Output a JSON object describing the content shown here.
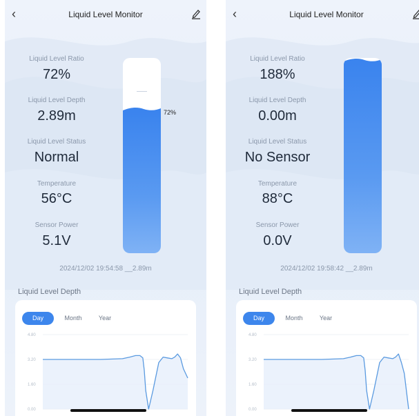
{
  "screens": [
    {
      "header": {
        "title": "Liquid Level Monitor"
      },
      "stats": [
        {
          "label": "Liquid Level Ratio",
          "value": "72%"
        },
        {
          "label": "Liquid Level Depth",
          "value": "2.89m"
        },
        {
          "label": "Liquid Level Status",
          "value": "Normal"
        },
        {
          "label": "Temperature",
          "value": "56°C"
        },
        {
          "label": "Sensor Power",
          "value": "5.1V"
        }
      ],
      "tank": {
        "fill_fraction": 0.72,
        "percent_label": "72%"
      },
      "timestamp": "2024/12/02 19:54:58 __2.89m",
      "chart_section": {
        "title": "Liquid Level Depth",
        "tabs": [
          "Day",
          "Month",
          "Year"
        ],
        "active_tab": "Day"
      },
      "chart_data": {
        "type": "area",
        "title": "Liquid Level Depth",
        "y_ticks": [
          "4.80",
          "3.20",
          "1.60",
          "0.00"
        ],
        "ylim": [
          0,
          4.8
        ],
        "x": [
          0,
          0.4,
          0.55,
          0.6,
          0.64,
          0.67,
          0.69,
          0.7,
          0.71,
          0.73,
          0.76,
          0.8,
          0.83,
          0.86,
          0.89,
          0.91,
          0.93,
          0.95,
          0.97,
          1.0
        ],
        "y": [
          3.2,
          3.2,
          3.25,
          3.35,
          3.45,
          3.45,
          3.3,
          2.5,
          1.2,
          0.0,
          1.2,
          3.0,
          3.35,
          3.3,
          3.25,
          3.35,
          3.55,
          3.3,
          2.6,
          2.0
        ]
      }
    },
    {
      "header": {
        "title": "Liquid Level Monitor"
      },
      "stats": [
        {
          "label": "Liquid Level Ratio",
          "value": "188%"
        },
        {
          "label": "Liquid Level Depth",
          "value": "0.00m"
        },
        {
          "label": "Liquid Level Status",
          "value": "No Sensor"
        },
        {
          "label": "Temperature",
          "value": "88°C"
        },
        {
          "label": "Sensor Power",
          "value": "0.0V"
        }
      ],
      "tank": {
        "fill_fraction": 1.0,
        "percent_label": ""
      },
      "timestamp": "2024/12/02 19:58:42 __2.89m",
      "chart_section": {
        "title": "Liquid Level Depth",
        "tabs": [
          "Day",
          "Month",
          "Year"
        ],
        "active_tab": "Day"
      },
      "chart_data": {
        "type": "area",
        "title": "Liquid Level Depth",
        "y_ticks": [
          "4.80",
          "3.20",
          "1.60",
          "0.00"
        ],
        "ylim": [
          0,
          4.8
        ],
        "x": [
          0,
          0.4,
          0.55,
          0.6,
          0.64,
          0.67,
          0.69,
          0.7,
          0.71,
          0.73,
          0.76,
          0.8,
          0.83,
          0.86,
          0.89,
          0.91,
          0.93,
          0.95,
          0.97,
          1.0
        ],
        "y": [
          3.2,
          3.2,
          3.25,
          3.35,
          3.45,
          3.45,
          3.3,
          2.5,
          1.2,
          0.0,
          1.2,
          3.0,
          3.35,
          3.3,
          3.25,
          3.35,
          3.55,
          3.0,
          2.3,
          0.0
        ]
      }
    }
  ],
  "colors": {
    "accent": "#3d86ec",
    "tank_fill": "#4a8ff0",
    "line": "#5a9ae0",
    "area": "#e6effb",
    "text_muted": "#8a97aa",
    "text_main": "#1f2a3a"
  },
  "icons": {
    "back": "chevron-left-icon",
    "edit": "pencil-icon"
  }
}
